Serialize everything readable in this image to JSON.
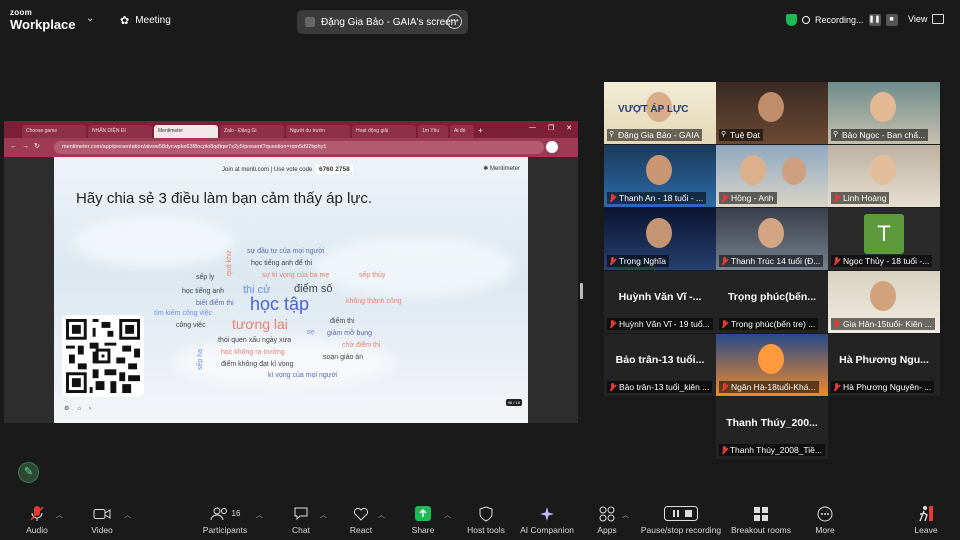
{
  "app": {
    "logo_line1": "zoom",
    "logo_line2": "Workplace"
  },
  "header": {
    "meeting_label": "Meeting",
    "share_title": "Đặng Gia Bảo - GAIA's screen",
    "recording_label": "Recording...",
    "view_label": "View"
  },
  "browser": {
    "tabs": [
      "Choose game",
      "NHÂN DIỆN ĐỊ",
      "Mentimeter",
      "Zalo - Đặng Gi",
      "Người du trườn",
      "Hoạt động giải",
      "1m Yêu",
      "Ai đó"
    ],
    "url": "mentimeter.com/app/presentation/alvsw58dycwpke63f8ocplo8qdtqw7s2y5/present?question=rqm5d92bphy1"
  },
  "slide": {
    "join_text": "Join at menti.com | Use vote code",
    "vote_code": "6760 2758",
    "brand": "Mentimeter",
    "question": "Hãy chia sẻ 3 điều làm bạn cảm thấy áp lực.",
    "counter": "96 / 16"
  },
  "word_cloud": [
    {
      "text": "sự đầu tư của mọi người",
      "color": "#5b6bb0"
    },
    {
      "text": "học tiếng anh để thi",
      "color": "#444444"
    },
    {
      "text": "sự kì vọng của ba mẹ",
      "color": "#e8836f"
    },
    {
      "text": "sếp thủy",
      "color": "#e8836f"
    },
    {
      "text": "sếp ly",
      "color": "#444444"
    },
    {
      "text": "quá khứ",
      "color": "#e8836f"
    },
    {
      "text": "thi cử",
      "color": "#6d8ff0"
    },
    {
      "text": "điểm số",
      "color": "#444444"
    },
    {
      "text": "học tiếng anh",
      "color": "#444444"
    },
    {
      "text": "biết điểm thi",
      "color": "#5b6bb0"
    },
    {
      "text": "học tập",
      "color": "#4a62d8"
    },
    {
      "text": "không thành công",
      "color": "#e8836f"
    },
    {
      "text": "tìm kiếm công việc",
      "color": "#6d8ff0"
    },
    {
      "text": "công việc",
      "color": "#444444"
    },
    {
      "text": "tương lai",
      "color": "#e8836f"
    },
    {
      "text": "điểm thi",
      "color": "#444444"
    },
    {
      "text": "sẹ",
      "color": "#6d8ff0"
    },
    {
      "text": "giảm mỡ bụng",
      "color": "#5b6bb0"
    },
    {
      "text": "thói quen xấu ngày xưa",
      "color": "#444444"
    },
    {
      "text": "chờ điểm thi",
      "color": "#e8836f"
    },
    {
      "text": "học không ra trường",
      "color": "#e8836f"
    },
    {
      "text": "soạn giáo án",
      "color": "#444444"
    },
    {
      "text": "sếp hạ",
      "color": "#6d8ff0"
    },
    {
      "text": "điểm không đạt kì vọng",
      "color": "#444444"
    },
    {
      "text": "kì vọng của mọi người",
      "color": "#5b6bb0"
    }
  ],
  "participants": [
    {
      "name": "Đặng Gia Bảo - GAIA",
      "pinned": true,
      "muted": false,
      "speaking": true,
      "video_text": "VƯỢT ÁP LỰC"
    },
    {
      "name": "Tuệ Đạt",
      "pinned": true,
      "muted": false
    },
    {
      "name": "Bảo Ngọc - Ban chấ...",
      "pinned": true,
      "muted": false
    },
    {
      "name": "Thanh An - 18 tuổi - ...",
      "muted": true
    },
    {
      "name": "Hồng - Anh",
      "muted": true
    },
    {
      "name": "Linh Hoàng",
      "muted": true
    },
    {
      "name": "Trọng Nghĩa",
      "muted": true
    },
    {
      "name": "Thanh Trúc 14 tuổi (Đ...",
      "muted": true
    },
    {
      "name": "Ngọc Thủy - 18 tuổi -...",
      "muted": true,
      "initial": "T"
    },
    {
      "name": "Huỳnh Văn Vĩ - 19 tuổ...",
      "muted": true,
      "big_name": "Huỳnh Văn Vĩ -..."
    },
    {
      "name": "Trọng phúc(bến tre) ...",
      "muted": true,
      "big_name": "Trọng phúc(bến..."
    },
    {
      "name": "Gia Hân-15tuổi- Kiên ...",
      "muted": true
    },
    {
      "name": "Bảo trân-13 tuổi_kiên ...",
      "muted": true,
      "big_name": "Bảo trân-13 tuổi..."
    },
    {
      "name": "Ngân Hà-18tuổi-Khá...",
      "muted": true
    },
    {
      "name": "Hà Phương Nguyên- ...",
      "muted": true,
      "big_name": "Hà Phương Ngu..."
    },
    {
      "name": "Thanh Thúy_2008_Tiề...",
      "muted": true,
      "big_name": "Thanh Thúy_200..."
    }
  ],
  "toolbar": {
    "audio": "Audio",
    "video": "Video",
    "participants": "Participants",
    "participants_count": "16",
    "chat": "Chat",
    "react": "React",
    "share": "Share",
    "host_tools": "Host tools",
    "ai_companion": "AI Companion",
    "apps": "Apps",
    "recording": "Pause/stop recording",
    "breakout": "Breakout rooms",
    "more": "More",
    "leave": "Leave"
  },
  "colors": {
    "accent_green": "#27c26a",
    "mute_red": "#e53935",
    "share_green": "#1db954",
    "browser_maroon": "#7b2038"
  }
}
